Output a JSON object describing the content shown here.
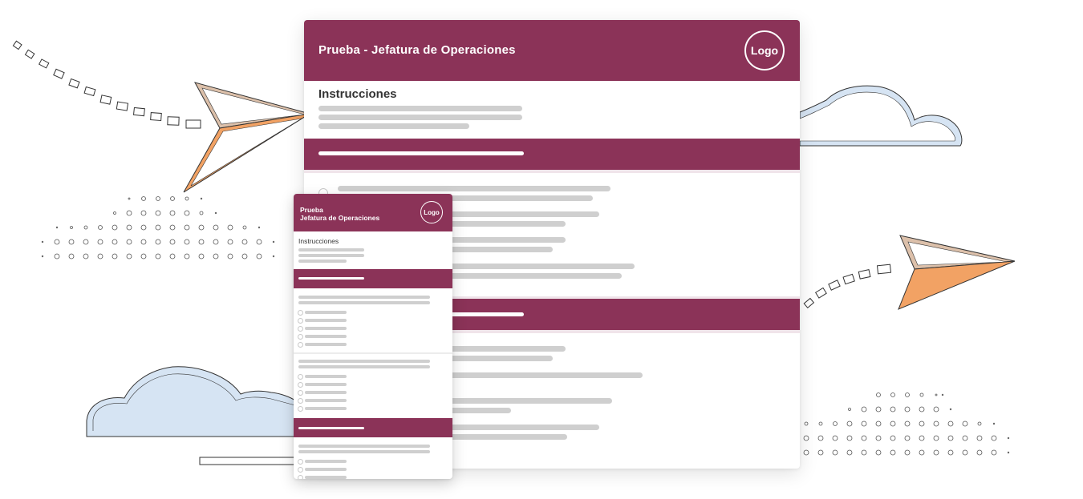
{
  "big_form": {
    "title": "Prueba - Jefatura de Operaciones",
    "logo": "Logo",
    "instructions_heading": "Instrucciones"
  },
  "small_form": {
    "title_line1": "Prueba",
    "title_line2": "Jefatura de Operaciones",
    "logo": "Logo",
    "instructions_heading": "Instrucciones"
  },
  "colors": {
    "brand": "#8b3358",
    "plane_orange": "#f0a060",
    "plane_tan": "#d9b8a0",
    "cloud_blue": "#c8d9ee",
    "placeholder_gray": "#cfcfcf"
  },
  "decorations": [
    "paper-plane-icon",
    "cloud-icon",
    "dotted-trail",
    "dot-grid"
  ]
}
